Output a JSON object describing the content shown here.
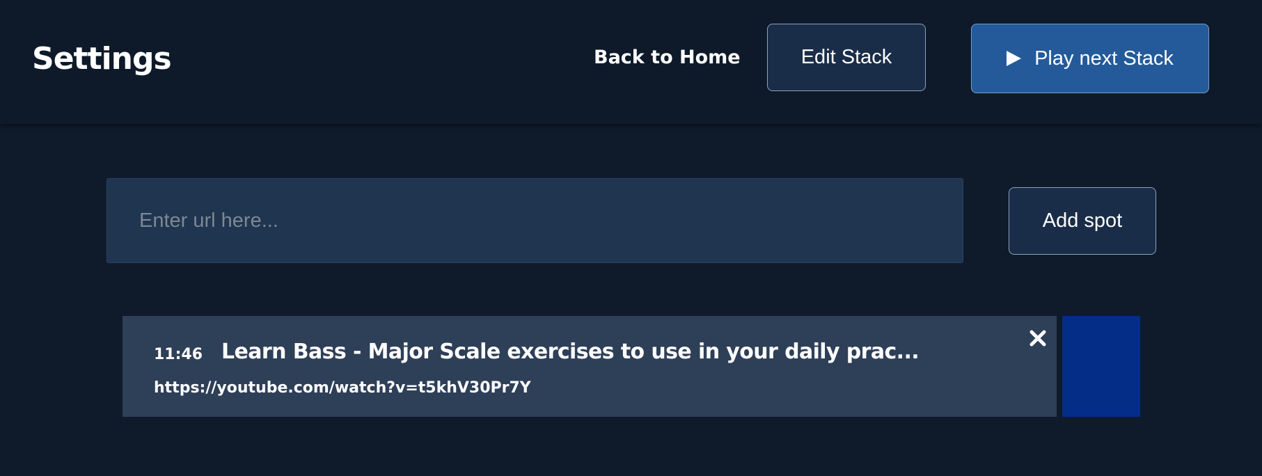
{
  "header": {
    "title": "Settings",
    "back_link": "Back to Home",
    "edit_button": "Edit Stack",
    "play_button": "Play next Stack",
    "play_icon": "play-icon"
  },
  "add_spot": {
    "input_value": "",
    "placeholder": "Enter url here...",
    "button_label": "Add spot"
  },
  "spots": [
    {
      "time": "11:46",
      "title": "Learn Bass - Major Scale exercises to use in your daily prac...",
      "url": "https://youtube.com/watch?v=t5khV30Pr7Y",
      "close_icon": "close-icon",
      "swatch_color": "#032d87"
    }
  ],
  "colors": {
    "background": "#0f1b2b",
    "header_background": "#0e1a2a",
    "input_background": "#1f3550",
    "card_background": "#2e3f58",
    "primary_button": "#245a9a",
    "secondary_button": "#1a2d48"
  }
}
